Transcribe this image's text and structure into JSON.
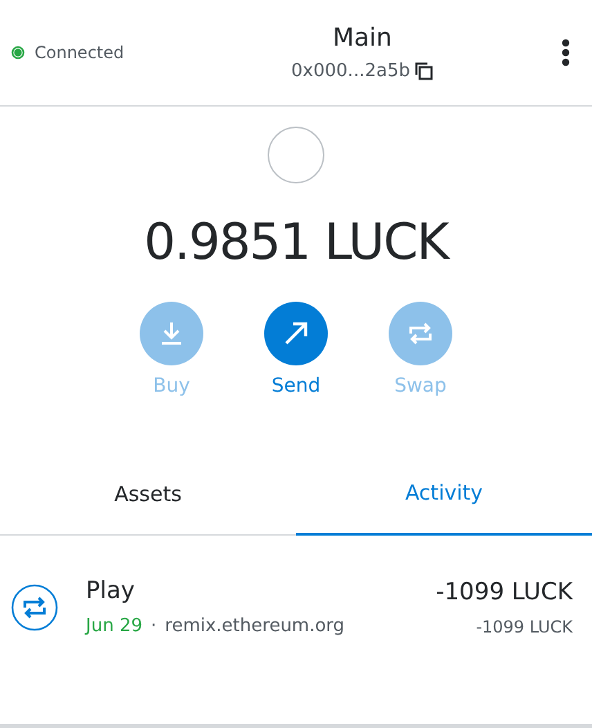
{
  "header": {
    "status": {
      "label": "Connected",
      "connected": true
    },
    "account_name": "Main",
    "address": "0x000...2a5b"
  },
  "balance": "0.9851 LUCK",
  "actions": [
    {
      "kind": "download",
      "label": "Buy",
      "disabled": true
    },
    {
      "kind": "send",
      "label": "Send",
      "disabled": false
    },
    {
      "kind": "swap",
      "label": "Swap",
      "disabled": true
    }
  ],
  "tabs": [
    {
      "label": "Assets",
      "selected": false
    },
    {
      "label": "Activity",
      "selected": true
    }
  ],
  "activity": [
    {
      "title": "Play",
      "date": "Jun 29",
      "separator": "·",
      "origin": "remix.ethereum.org",
      "amount": "-1099 LUCK",
      "secondary_amount": "-1099 LUCK"
    }
  ]
}
